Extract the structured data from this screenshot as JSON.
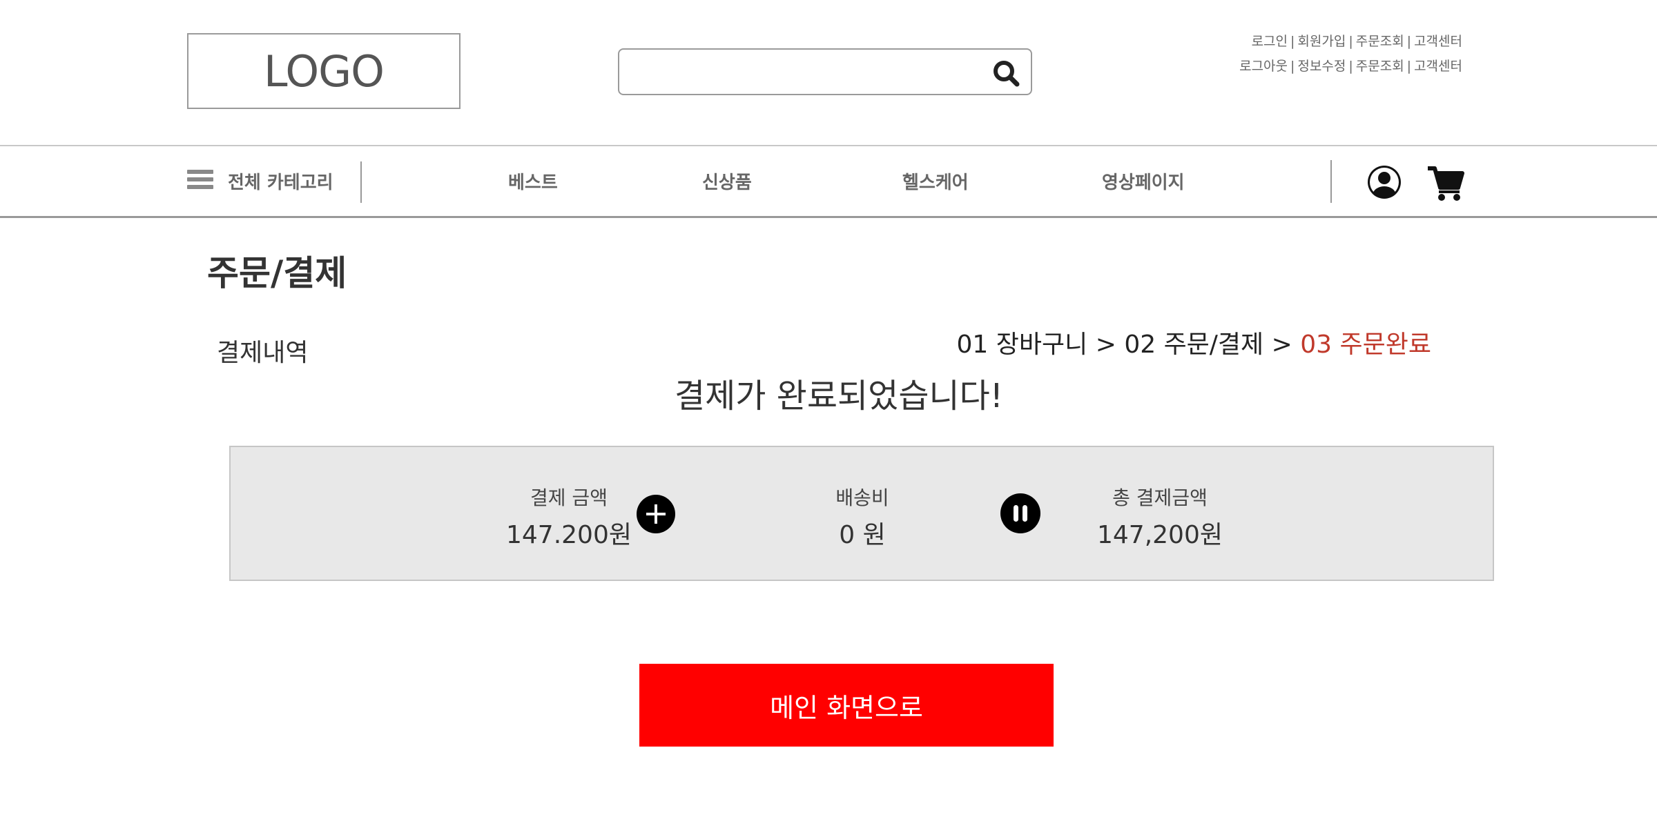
{
  "header": {
    "logo_text": "LOGO",
    "search": {
      "value": "",
      "placeholder": ""
    },
    "util_row_1": [
      "로그인",
      "회원가입",
      "주문조회",
      "고객센터"
    ],
    "util_row_2": [
      "로그아웃",
      "정보수정",
      "주문조회",
      "고객센터"
    ],
    "separator": "|"
  },
  "nav": {
    "category_label": "전체 카테고리",
    "items": [
      "베스트",
      "신상품",
      "헬스케어",
      "영상페이지"
    ]
  },
  "page": {
    "title": "주문/결제",
    "section_label": "결제내역",
    "breadcrumb": {
      "step1": "01 장바구니",
      "sep": ">",
      "step2": "02 주문/결제",
      "step3": "03 주문완료"
    },
    "complete_message": "결제가 완료되었습니다!",
    "summary": {
      "payment_label": "결제 금액",
      "payment_value": "147.200원",
      "shipping_label": "배송비",
      "shipping_value": "0 원",
      "total_label": "총 결제금액",
      "total_value": "147,200원"
    },
    "main_button_label": "메인 화면으로"
  },
  "colors": {
    "accent_red": "#ff0000",
    "breadcrumb_current": "#c0392b",
    "summary_bg": "#e8e8e8"
  },
  "icons": [
    "search-icon",
    "hamburger-icon",
    "user-icon",
    "cart-icon",
    "plus-icon",
    "equal-icon"
  ]
}
